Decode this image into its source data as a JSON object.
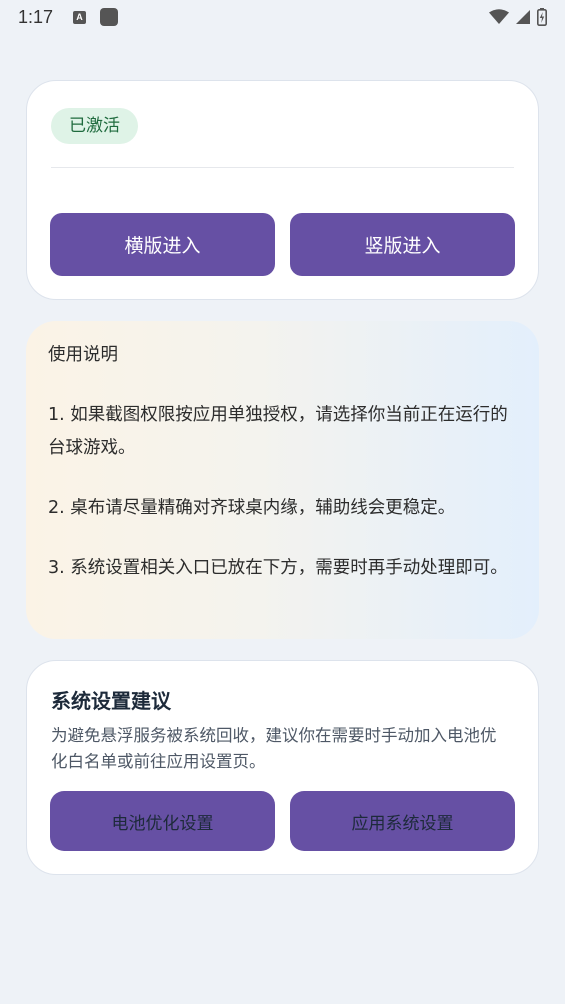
{
  "status_bar": {
    "time": "1:17",
    "a_icon_letter": "A"
  },
  "activation": {
    "badge": "已激活",
    "landscape_button": "横版进入",
    "portrait_button": "竖版进入"
  },
  "instructions": {
    "title": "使用说明",
    "item1": "1. 如果截图权限按应用单独授权，请选择你当前正在运行的台球游戏。",
    "item2": "2. 桌布请尽量精确对齐球桌内缘，辅助线会更稳定。",
    "item3": "3. 系统设置相关入口已放在下方，需要时再手动处理即可。"
  },
  "settings": {
    "title": "系统设置建议",
    "description": "为避免悬浮服务被系统回收，建议你在需要时手动加入电池优化白名单或前往应用设置页。",
    "battery_button": "电池优化设置",
    "app_settings_button": "应用系统设置"
  },
  "colors": {
    "primary_button": "#6650a4",
    "badge_background": "#dff3e7",
    "badge_text": "#1f6b3e",
    "page_background": "#eef2f7"
  }
}
